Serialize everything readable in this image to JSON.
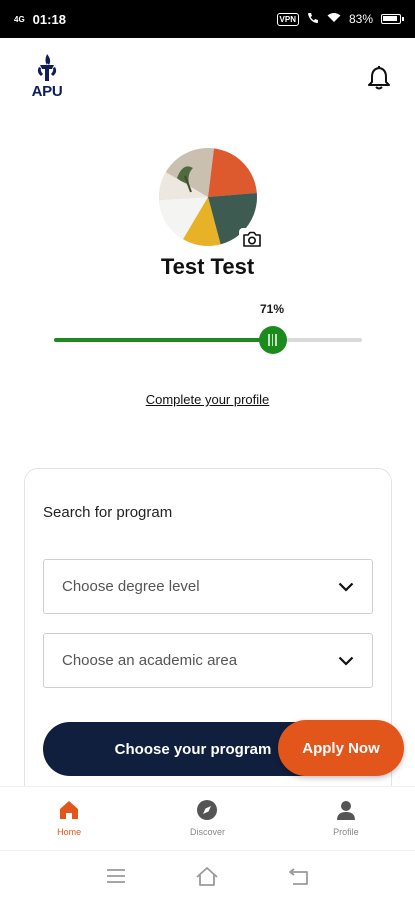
{
  "status_bar": {
    "time": "01:18",
    "network": "4G",
    "vpn": "VPN",
    "battery": "83%"
  },
  "header": {
    "logo_text": "APU",
    "accent": "#0f1e5a"
  },
  "profile": {
    "name": "Test Test",
    "progress_percent": 71,
    "progress_label": "71%",
    "complete_link": "Complete your profile",
    "progress_color": "#1c8a1c"
  },
  "search": {
    "title": "Search for program",
    "degree_placeholder": "Choose degree level",
    "area_placeholder": "Choose an academic area",
    "cta_label": "Choose your program"
  },
  "fab": {
    "label": "Apply Now",
    "color": "#e3561b"
  },
  "bottom_nav": {
    "items": [
      {
        "label": "Home",
        "icon": "home-icon",
        "active": true
      },
      {
        "label": "Discover",
        "icon": "compass-icon",
        "active": false
      },
      {
        "label": "Profile",
        "icon": "person-icon",
        "active": false
      }
    ]
  },
  "system_nav": {
    "icons": [
      "menu-icon",
      "home-outline-icon",
      "back-icon"
    ]
  }
}
